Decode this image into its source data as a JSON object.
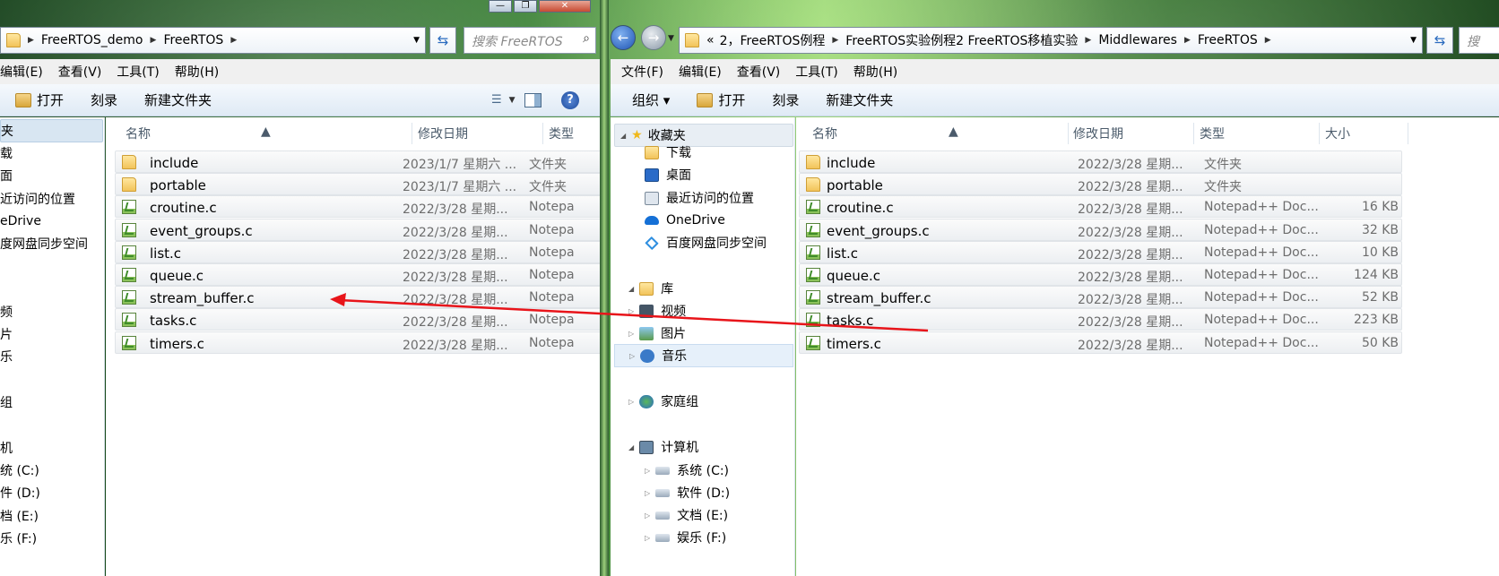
{
  "colors": {
    "selection": "#cce8ff",
    "arrow": "#e8141a",
    "hover": "#d8e6f2",
    "toolbar_bg": "#e8f0f8"
  },
  "left_window": {
    "address_crumbs": [
      "FreeRTOS_demo",
      "FreeRTOS"
    ],
    "search_placeholder": "搜索 FreeRTOS",
    "menu": [
      "编辑(E)",
      "查看(V)",
      "工具(T)",
      "帮助(H)"
    ],
    "toolbar": {
      "open": "打开",
      "burn": "刻录",
      "new_folder": "新建文件夹"
    },
    "nav_items": [
      "夹",
      "载",
      "面",
      "近访问的位置",
      "eDrive",
      "度网盘同步空间",
      "频",
      "片",
      "乐",
      "组",
      "机",
      "统 (C:)",
      "件 (D:)",
      "档 (E:)",
      "乐 (F:)"
    ],
    "columns": {
      "name": "名称",
      "date": "修改日期",
      "type": "类型"
    },
    "files": [
      {
        "name": "include",
        "date": "2023/1/7 星期六 ...",
        "type": "文件夹",
        "icon": "folder-icon"
      },
      {
        "name": "portable",
        "date": "2023/1/7 星期六 ...",
        "type": "文件夹",
        "icon": "folder-icon"
      },
      {
        "name": "croutine.c",
        "date": "2022/3/28 星期...",
        "type": "Notepa",
        "icon": "notepadpp-file-icon"
      },
      {
        "name": "event_groups.c",
        "date": "2022/3/28 星期...",
        "type": "Notepa",
        "icon": "notepadpp-file-icon"
      },
      {
        "name": "list.c",
        "date": "2022/3/28 星期...",
        "type": "Notepa",
        "icon": "notepadpp-file-icon"
      },
      {
        "name": "queue.c",
        "date": "2022/3/28 星期...",
        "type": "Notepa",
        "icon": "notepadpp-file-icon"
      },
      {
        "name": "stream_buffer.c",
        "date": "2022/3/28 星期...",
        "type": "Notepa",
        "icon": "notepadpp-file-icon"
      },
      {
        "name": "tasks.c",
        "date": "2022/3/28 星期...",
        "type": "Notepa",
        "icon": "notepadpp-file-icon"
      },
      {
        "name": "timers.c",
        "date": "2022/3/28 星期...",
        "type": "Notepa",
        "icon": "notepadpp-file-icon"
      }
    ]
  },
  "right_window": {
    "address_prefix": "«",
    "address_crumbs": [
      "2，FreeRTOS例程",
      "FreeRTOS实验例程2 FreeRTOS移植实验",
      "Middlewares",
      "FreeRTOS"
    ],
    "search_placeholder": "搜",
    "menu": [
      "文件(F)",
      "编辑(E)",
      "查看(V)",
      "工具(T)",
      "帮助(H)"
    ],
    "toolbar": {
      "organize": "组织 ▾",
      "open": "打开",
      "burn": "刻录",
      "new_folder": "新建文件夹"
    },
    "nav": {
      "favorites": "收藏夹",
      "fav_items": [
        "下载",
        "桌面",
        "最近访问的位置",
        "OneDrive",
        "百度网盘同步空间"
      ],
      "library": "库",
      "lib_items": [
        "视频",
        "图片",
        "音乐"
      ],
      "homegroup": "家庭组",
      "computer": "计算机",
      "drives": [
        "系统 (C:)",
        "软件 (D:)",
        "文档 (E:)",
        "娱乐 (F:)"
      ]
    },
    "columns": {
      "name": "名称",
      "date": "修改日期",
      "type": "类型",
      "size": "大小"
    },
    "files": [
      {
        "name": "include",
        "date": "2022/3/28 星期...",
        "type": "文件夹",
        "size": "",
        "icon": "folder-icon"
      },
      {
        "name": "portable",
        "date": "2022/3/28 星期...",
        "type": "文件夹",
        "size": "",
        "icon": "folder-icon"
      },
      {
        "name": "croutine.c",
        "date": "2022/3/28 星期...",
        "type": "Notepad++ Doc...",
        "size": "16 KB",
        "icon": "notepadpp-file-icon"
      },
      {
        "name": "event_groups.c",
        "date": "2022/3/28 星期...",
        "type": "Notepad++ Doc...",
        "size": "32 KB",
        "icon": "notepadpp-file-icon"
      },
      {
        "name": "list.c",
        "date": "2022/3/28 星期...",
        "type": "Notepad++ Doc...",
        "size": "10 KB",
        "icon": "notepadpp-file-icon"
      },
      {
        "name": "queue.c",
        "date": "2022/3/28 星期...",
        "type": "Notepad++ Doc...",
        "size": "124 KB",
        "icon": "notepadpp-file-icon"
      },
      {
        "name": "stream_buffer.c",
        "date": "2022/3/28 星期...",
        "type": "Notepad++ Doc...",
        "size": "52 KB",
        "icon": "notepadpp-file-icon"
      },
      {
        "name": "tasks.c",
        "date": "2022/3/28 星期...",
        "type": "Notepad++ Doc...",
        "size": "223 KB",
        "icon": "notepadpp-file-icon"
      },
      {
        "name": "timers.c",
        "date": "2022/3/28 星期...",
        "type": "Notepad++ Doc...",
        "size": "50 KB",
        "icon": "notepadpp-file-icon"
      }
    ]
  }
}
